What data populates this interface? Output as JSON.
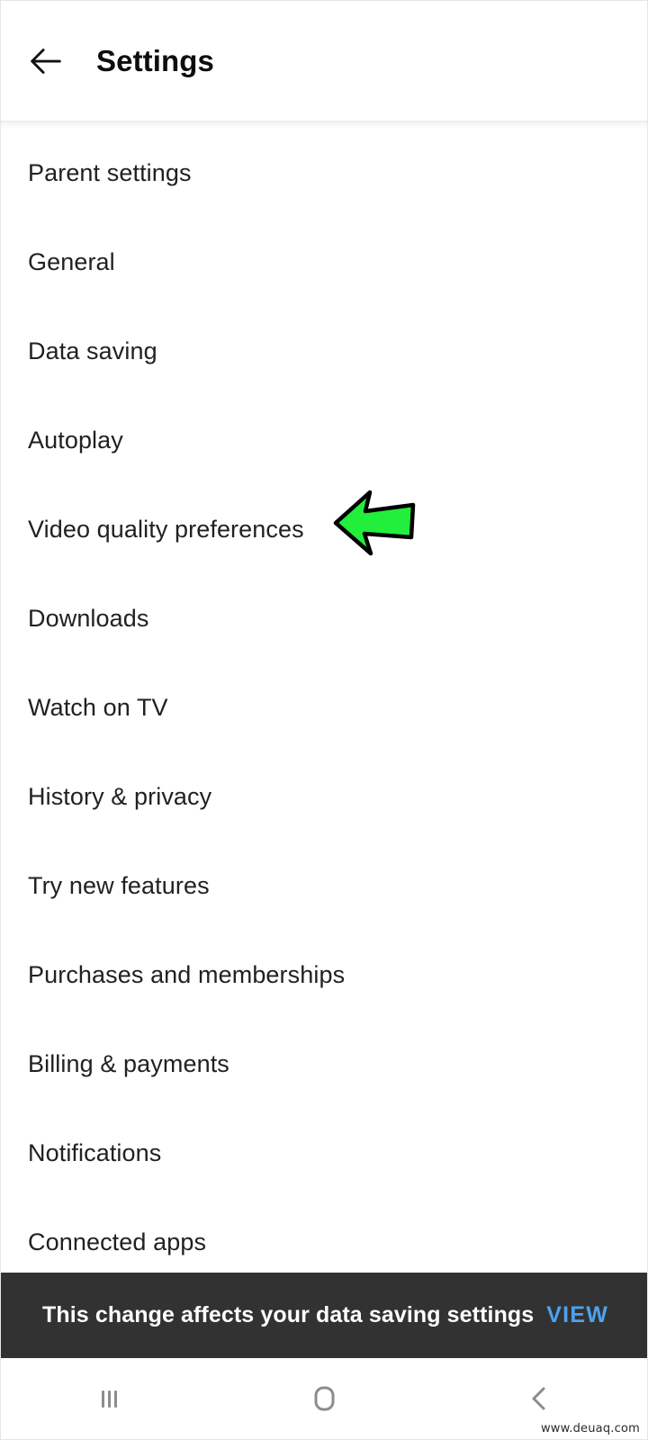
{
  "header": {
    "title": "Settings",
    "back_icon": "arrow-left-icon"
  },
  "settings": {
    "items": [
      {
        "label": "Parent settings"
      },
      {
        "label": "General"
      },
      {
        "label": "Data saving"
      },
      {
        "label": "Autoplay"
      },
      {
        "label": "Video quality preferences"
      },
      {
        "label": "Downloads"
      },
      {
        "label": "Watch on TV"
      },
      {
        "label": "History & privacy"
      },
      {
        "label": "Try new features"
      },
      {
        "label": "Purchases and memberships"
      },
      {
        "label": "Billing & payments"
      },
      {
        "label": "Notifications"
      },
      {
        "label": "Connected apps"
      }
    ]
  },
  "annotation": {
    "type": "arrow-left",
    "points_at": "Video quality preferences",
    "fill_color": "#22EE3C",
    "stroke_color": "#000000"
  },
  "snackbar": {
    "message": "This change affects your data saving settings",
    "action_label": "VIEW",
    "background_color": "#323232",
    "action_color": "#4DA2F0"
  },
  "navbar": {
    "recents_icon": "recents-icon",
    "home_icon": "home-icon",
    "back_icon": "back-chevron-icon"
  },
  "watermark": {
    "text": "www.deuaq.com"
  }
}
